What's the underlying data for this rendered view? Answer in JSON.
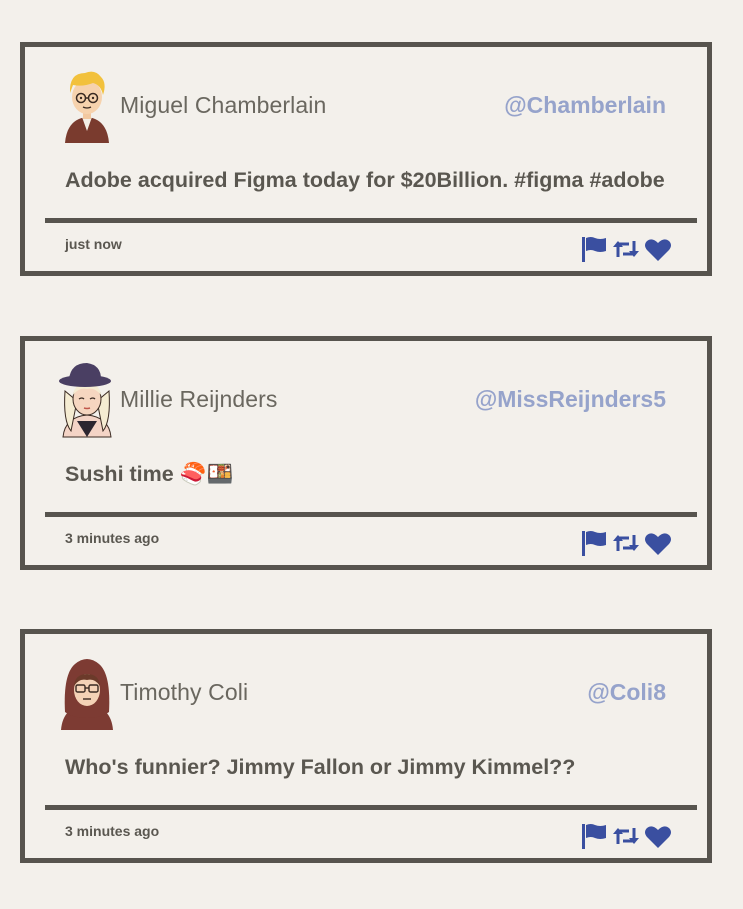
{
  "tweets": [
    {
      "name": "Miguel Chamberlain",
      "handle": "@Chamberlain",
      "message": "Adobe acquired Figma today for $20Billion. #figma #adobe",
      "time": "just now",
      "avatar": "blond-man-glasses-avatar"
    },
    {
      "name": "Millie Reijnders",
      "handle": "@MissReijnders5",
      "message": "Sushi time 🍣🍱",
      "time": "3 minutes ago",
      "avatar": "woman-hat-avatar"
    },
    {
      "name": "Timothy Coli",
      "handle": "@Coli8",
      "message": "Who's funnier? Jimmy Fallon or Jimmy Kimmel??",
      "time": "3 minutes ago",
      "avatar": "hooded-man-glasses-avatar"
    }
  ],
  "icons": [
    "flag-icon",
    "retweet-icon",
    "heart-icon"
  ],
  "colors": {
    "background": "#f3f0eb",
    "border": "#57544e",
    "handle": "#96a3cb",
    "icon": "#3a4fa0",
    "text": "#5a5750"
  }
}
